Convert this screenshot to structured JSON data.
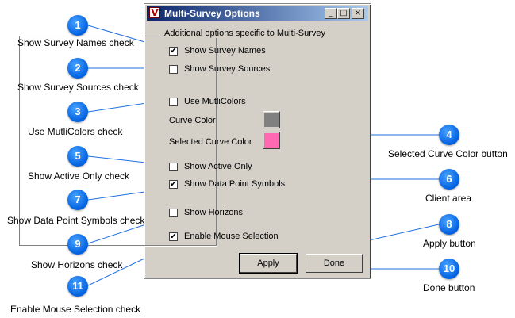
{
  "window": {
    "title": "Multi-Survey Options",
    "min": "_",
    "max": "□",
    "close": "×",
    "app_icon": "V"
  },
  "group_label": "Additional options specific to Multi-Survey",
  "options": {
    "show_survey_names": {
      "label": "Show Survey Names",
      "checked": true
    },
    "show_survey_sources": {
      "label": "Show Survey Sources",
      "checked": false
    },
    "use_multicolors": {
      "label": "Use MutliColors",
      "checked": false
    },
    "show_active_only": {
      "label": "Show Active Only",
      "checked": false
    },
    "show_data_point_symbols": {
      "label": "Show Data Point Symbols",
      "checked": true
    },
    "show_horizons": {
      "label": "Show Horizons",
      "checked": false
    },
    "enable_mouse_selection": {
      "label": "Enable Mouse Selection",
      "checked": true
    }
  },
  "curve_color": {
    "label": "Curve Color",
    "color": "#808080"
  },
  "selected_curve_color": {
    "label": "Selected Curve Color",
    "color": "#ff69b4"
  },
  "buttons": {
    "apply": "Apply",
    "done": "Done"
  },
  "callouts": [
    {
      "n": "1",
      "text": "Show Survey Names check"
    },
    {
      "n": "2",
      "text": "Show Survey Sources check"
    },
    {
      "n": "3",
      "text": "Use MutliColors check"
    },
    {
      "n": "4",
      "text": "Selected Curve Color button"
    },
    {
      "n": "5",
      "text": "Show Active Only check"
    },
    {
      "n": "6",
      "text": "Client area"
    },
    {
      "n": "7",
      "text": "Show Data Point Symbols check"
    },
    {
      "n": "8",
      "text": "Apply button"
    },
    {
      "n": "9",
      "text": "Show Horizons check"
    },
    {
      "n": "10",
      "text": "Done button"
    },
    {
      "n": "11",
      "text": "Enable Mouse Selection check"
    }
  ],
  "colors": {
    "titlebar_start": "#0a246a",
    "titlebar_end": "#a6caf0",
    "dialog_bg": "#d4d0c8",
    "badge": "#0060e0"
  }
}
